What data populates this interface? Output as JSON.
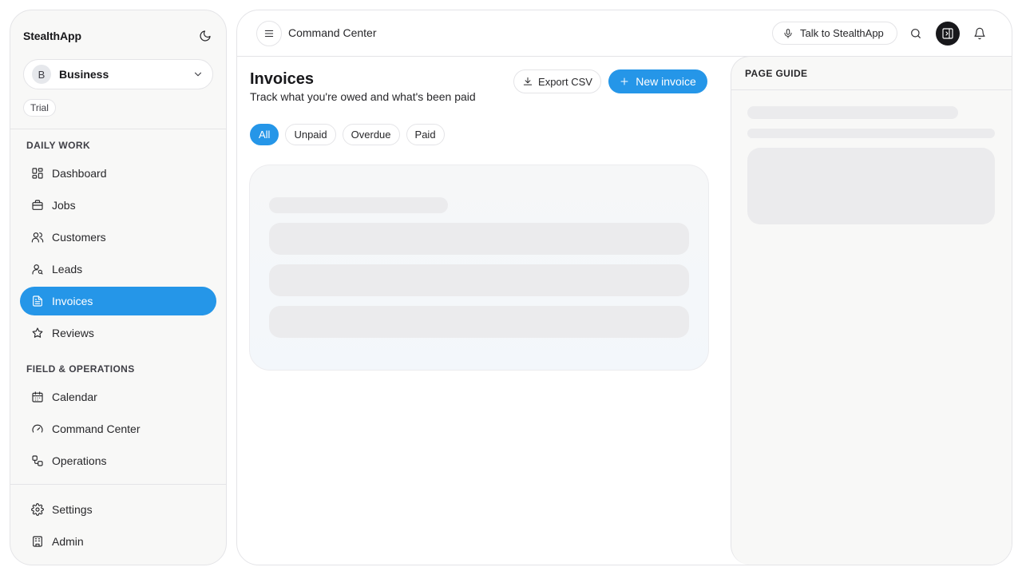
{
  "sidebar": {
    "brand": "StealthApp",
    "business": {
      "avatar_letter": "B",
      "name": "Business"
    },
    "plan_badge": "Trial",
    "sections": [
      {
        "label": "DAILY WORK"
      },
      {
        "label": "FIELD & OPERATIONS"
      }
    ],
    "items": [
      {
        "label": "Dashboard",
        "icon": "dashboard-icon"
      },
      {
        "label": "Jobs",
        "icon": "briefcase-icon"
      },
      {
        "label": "Customers",
        "icon": "users-icon"
      },
      {
        "label": "Leads",
        "icon": "user-search-icon"
      },
      {
        "label": "Invoices",
        "icon": "invoice-icon",
        "active": true
      },
      {
        "label": "Reviews",
        "icon": "star-icon"
      },
      {
        "label": "Calendar",
        "icon": "calendar-icon"
      },
      {
        "label": "Command Center",
        "icon": "gauge-icon"
      },
      {
        "label": "Operations",
        "icon": "workflow-icon"
      },
      {
        "label": "Settings",
        "icon": "gear-icon"
      },
      {
        "label": "Admin",
        "icon": "building-icon"
      }
    ]
  },
  "topbar": {
    "title": "Command Center",
    "talk_label": "Talk to StealthApp"
  },
  "page": {
    "title": "Invoices",
    "subtitle": "Track what you're owed and what's been paid",
    "export_label": "Export CSV",
    "new_label": "New invoice",
    "filters": [
      "All",
      "Unpaid",
      "Overdue",
      "Paid"
    ],
    "active_filter": "All"
  },
  "guide": {
    "title": "PAGE GUIDE"
  },
  "colors": {
    "accent": "#2596e8",
    "skeleton": "#ebebed"
  }
}
